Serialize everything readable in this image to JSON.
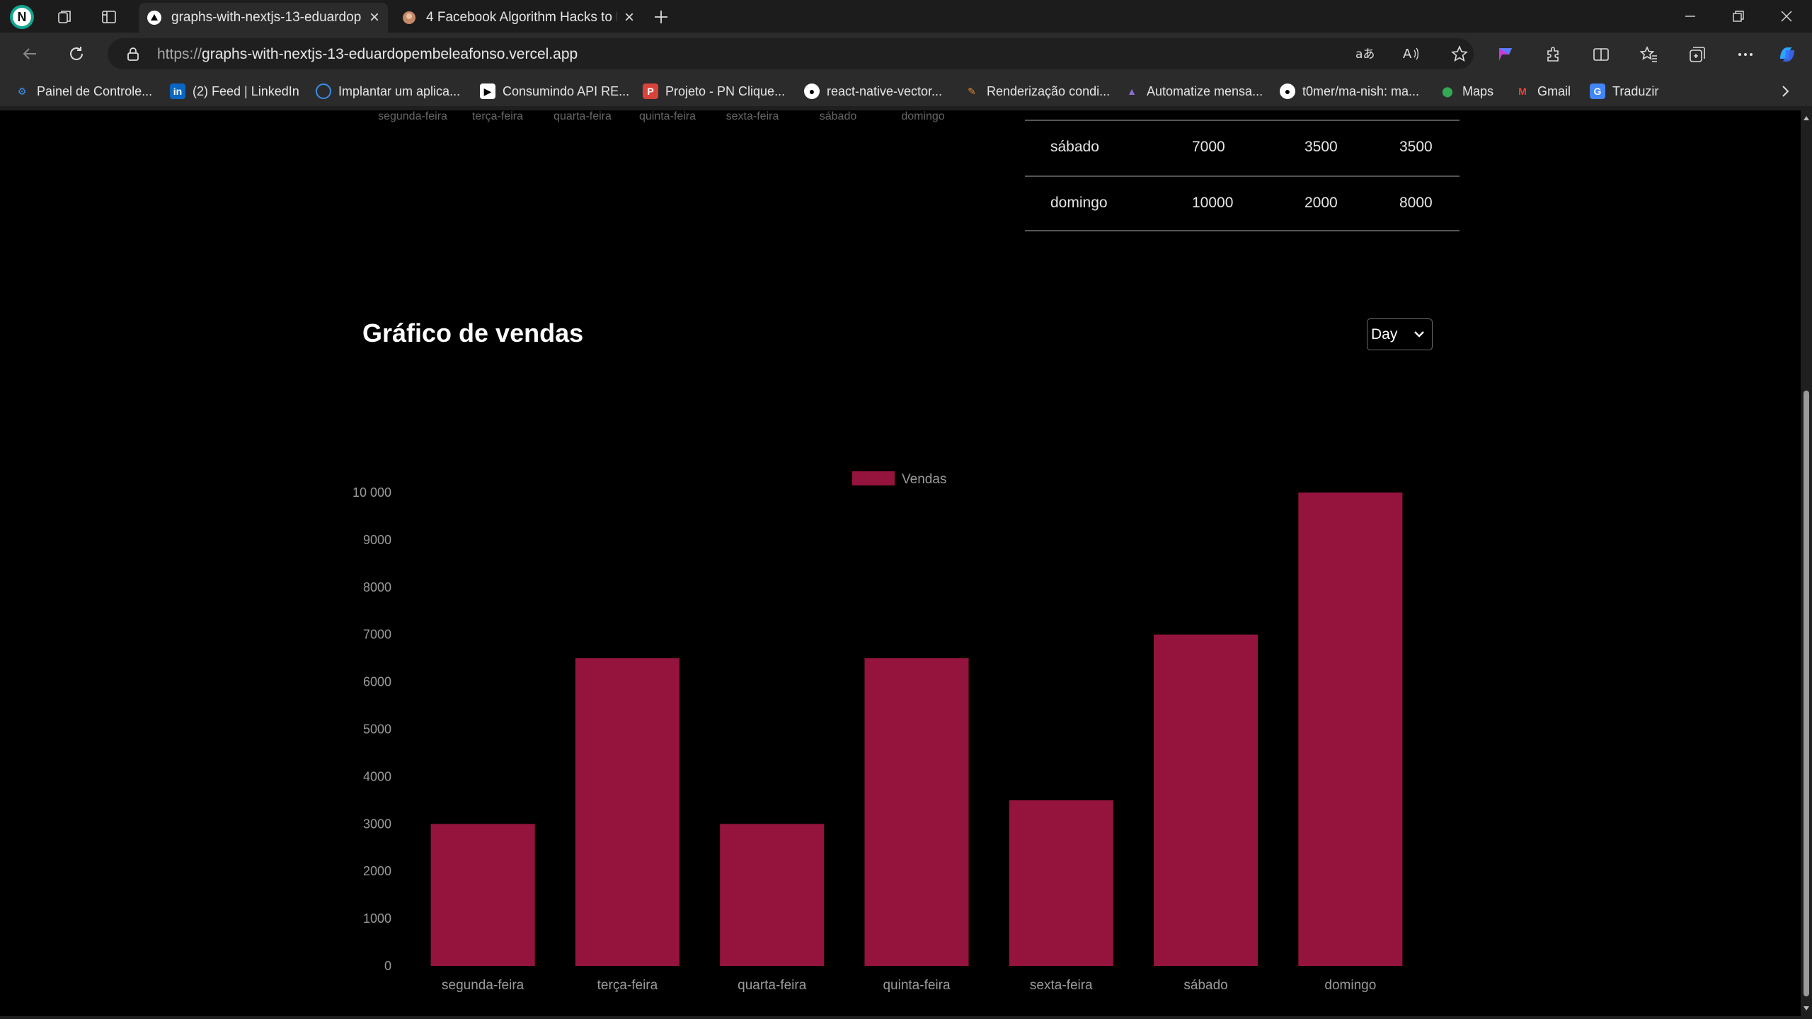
{
  "browser": {
    "profile_initial": "N",
    "tabs": [
      {
        "title": "graphs-with-nextjs-13-eduardop",
        "active": true
      },
      {
        "title": "4 Facebook Algorithm Hacks to E",
        "active": false
      }
    ],
    "url_scheme": "https://",
    "url_host": "graphs-with-nextjs-13-eduardopembeleafonso.vercel.app",
    "bookmarks": [
      {
        "label": "Painel de Controle...",
        "icon": "gear-icon"
      },
      {
        "label": "(2) Feed | LinkedIn",
        "icon": "linkedin-icon"
      },
      {
        "label": "Implantar um aplica...",
        "icon": "deploy-icon"
      },
      {
        "label": "Consumindo API RE...",
        "icon": "video-icon"
      },
      {
        "label": "Projeto - PN Clique...",
        "icon": "bookmark-icon"
      },
      {
        "label": "react-native-vector...",
        "icon": "github-icon"
      },
      {
        "label": "Renderização condi...",
        "icon": "pen-icon"
      },
      {
        "label": "Automatize mensa...",
        "icon": "automation-icon"
      },
      {
        "label": "t0mer/ma-nish: ma...",
        "icon": "github-icon"
      },
      {
        "label": "Maps",
        "icon": "maps-icon"
      },
      {
        "label": "Gmail",
        "icon": "gmail-icon"
      },
      {
        "label": "Traduzir",
        "icon": "translate-icon"
      }
    ]
  },
  "prev_chart_x_labels": [
    "segunda-feira",
    "terça-feira",
    "quarta-feira",
    "quinta-feira",
    "sexta-feira",
    "sábado",
    "domingo"
  ],
  "table": {
    "rows": [
      [
        "sábado",
        "7000",
        "3500",
        "3500"
      ],
      [
        "domingo",
        "10000",
        "2000",
        "8000"
      ]
    ]
  },
  "sales": {
    "title": "Gráfico de vendas",
    "period_select": "Day"
  },
  "colors": {
    "bar": "#94143e",
    "axis_text": "#9a9a9a",
    "background": "#000000"
  },
  "chart_data": {
    "type": "bar",
    "categories": [
      "segunda-feira",
      "terça-feira",
      "quarta-feira",
      "quinta-feira",
      "sexta-feira",
      "sábado",
      "domingo"
    ],
    "series": [
      {
        "name": "Vendas",
        "values": [
          3000,
          6500,
          3000,
          6500,
          3500,
          7000,
          10000
        ]
      }
    ],
    "yticks": [
      "0",
      "1000",
      "2000",
      "3000",
      "4000",
      "5000",
      "6000",
      "7000",
      "8000",
      "9000",
      "10 000"
    ],
    "ylim": [
      0,
      10000
    ],
    "legend": "top-center",
    "grid": false
  }
}
